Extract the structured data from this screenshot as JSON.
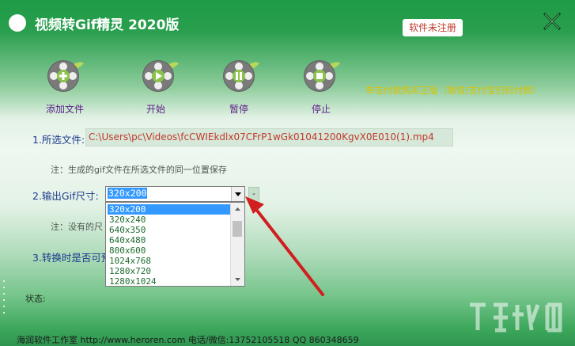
{
  "window": {
    "title": "视频转Gif精灵 2020版",
    "register_button": "软件未注册"
  },
  "toolbar": {
    "items": [
      {
        "label": "添加文件",
        "icon": "film-reel-add-icon"
      },
      {
        "label": "开始",
        "icon": "film-reel-play-icon"
      },
      {
        "label": "暂停",
        "icon": "film-reel-pause-icon"
      },
      {
        "label": "停止",
        "icon": "film-reel-stop-icon"
      }
    ],
    "promo_text": "单击付款购买正版（微信/支付宝扫码付款）"
  },
  "form": {
    "file_label": "1.所选文件:",
    "file_path": "C:\\Users\\pc\\Videos\\fcCWIEkdlx07CFrP1wGk01041200KgvX0E010(1).mp4",
    "file_note": "注：生成的gif文件在所选文件的同一位置保存",
    "size_label": "2.输出Gif尺寸:",
    "size_selected": "320x200",
    "size_button": "-",
    "size_note": "注：没有的尺",
    "convert_label": "3.转换时是否可预",
    "size_options": [
      "320x200",
      "320x240",
      "640x350",
      "640x480",
      "800x600",
      "1024x768",
      "1280x720",
      "1280x1024"
    ]
  },
  "status": {
    "label": "状态:"
  },
  "footer": {
    "text": "海润软件工作室 http://www.heroren.com  电话/微信:13752105518  QQ 860348659"
  },
  "colors": {
    "title_bar": "#1e9b46",
    "accent_red": "#c0392b",
    "label_blue": "#1b3a8c",
    "promo_yellow": "#d9c300",
    "selection_blue": "#3399ff"
  }
}
